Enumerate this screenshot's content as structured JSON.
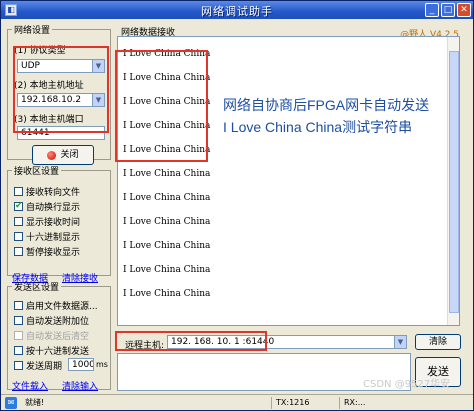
{
  "window": {
    "title": "网络调试助手",
    "version": "@野人 V4.2.5"
  },
  "net_settings": {
    "legend": "网络设置",
    "protocol_label": "(1) 协议类型",
    "protocol_value": "UDP",
    "local_host_label": "(2) 本地主机地址",
    "local_host_value": "192.168.10.2",
    "local_port_label": "(3) 本地主机端口",
    "local_port_value": "61441",
    "close_button": "关闭"
  },
  "recv_settings": {
    "legend": "接收区设置",
    "options": [
      {
        "label": "接收转向文件",
        "checked": false
      },
      {
        "label": "自动换行显示",
        "checked": true
      },
      {
        "label": "显示接收时间",
        "checked": false
      },
      {
        "label": "十六进制显示",
        "checked": false
      },
      {
        "label": "暂停接收显示",
        "checked": false
      }
    ],
    "save_link": "保存数据",
    "clear_link": "清除接收"
  },
  "send_settings": {
    "legend": "发送区设置",
    "options": [
      {
        "label": "启用文件数据源...",
        "checked": false,
        "disabled": false
      },
      {
        "label": "自动发送附加位",
        "checked": false,
        "disabled": false
      },
      {
        "label": "自动发送后清空",
        "checked": false,
        "disabled": true
      },
      {
        "label": "按十六进制发送",
        "checked": false,
        "disabled": false
      }
    ],
    "period_label": "发送周期",
    "period_value": "1000",
    "period_unit": "ms",
    "load_link": "文件载入",
    "clear_link": "清除输入"
  },
  "recv_area": {
    "legend": "网络数据接收",
    "lines": [
      "I Love China China",
      "I Love China China",
      "I Love China China",
      "I Love China China",
      "I Love China China",
      "I Love China China",
      "I Love China China",
      "I Love China China",
      "I Love China China",
      "I Love China China",
      "I Love China China"
    ]
  },
  "annotation": {
    "line1": "网络自协商后FPGA网卡自动发送",
    "line2": "I Love China China测试字符串"
  },
  "send_area": {
    "remote_label": "远程主机:",
    "remote_value": "192. 168. 10. 1  :61440",
    "clear_button": "清除",
    "send_button": "发送"
  },
  "status": {
    "state": "就绪!",
    "tx": "TX:1216",
    "rx": "RX:..."
  },
  "watermark": "CSDN @9527华安"
}
